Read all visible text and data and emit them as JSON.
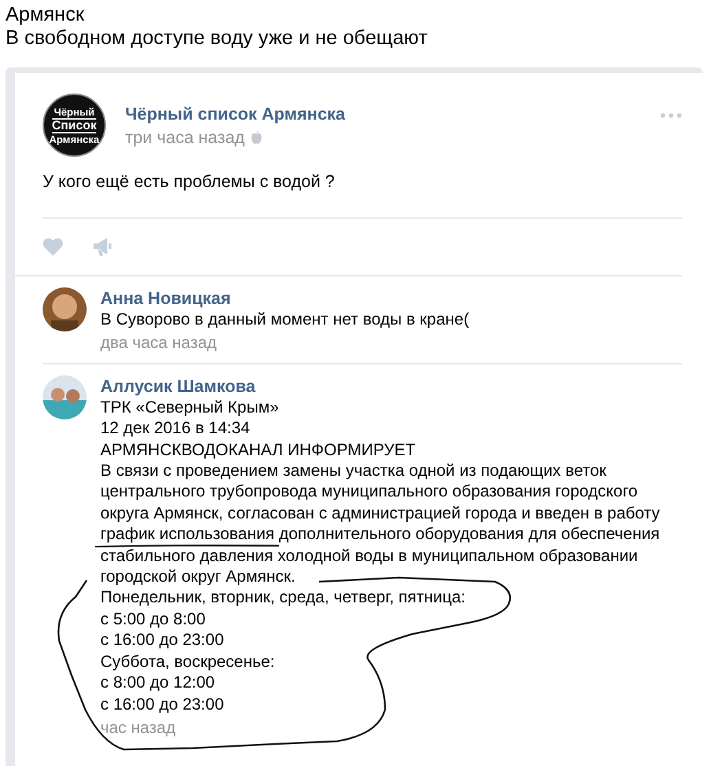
{
  "heading": [
    "Армянск",
    "В свободном доступе воду уже и не обещают"
  ],
  "post": {
    "avatar_text": [
      "Чёрный",
      "Список",
      "Армянска"
    ],
    "author": "Чёрный список Армянска",
    "time": "три часа назад",
    "text": "У кого ещё есть проблемы с водой ?"
  },
  "comments": [
    {
      "author": "Анна Новицкая",
      "lines": [
        "В Суворово в данный момент нет воды в кране("
      ],
      "time": "два часа назад"
    },
    {
      "author": "Аллусик Шамкова",
      "lines": [
        "ТРК «Северный Крым»",
        "12 дек 2016 в 14:34",
        "АРМЯНСКВОДОКАНАЛ ИНФОРМИРУЕТ",
        "В связи с проведением замены участка одной из подающих веток",
        "центрального трубопровода муниципального образования городского",
        "округа Армянск, согласован с администрацией города и введен в работу",
        "график использования дополнительного оборудования для обеспечения",
        "стабильного давления холодной воды в муниципальном образовании",
        "городской округ Армянск.",
        "Понедельник, вторник, среда, четверг, пятница:",
        "с 5:00 до 8:00",
        "с 16:00 до 23:00",
        "Суббота, воскресенье:",
        "с 8:00 до 12:00",
        "с 16:00 до 23:00"
      ],
      "time": "час назад"
    }
  ]
}
